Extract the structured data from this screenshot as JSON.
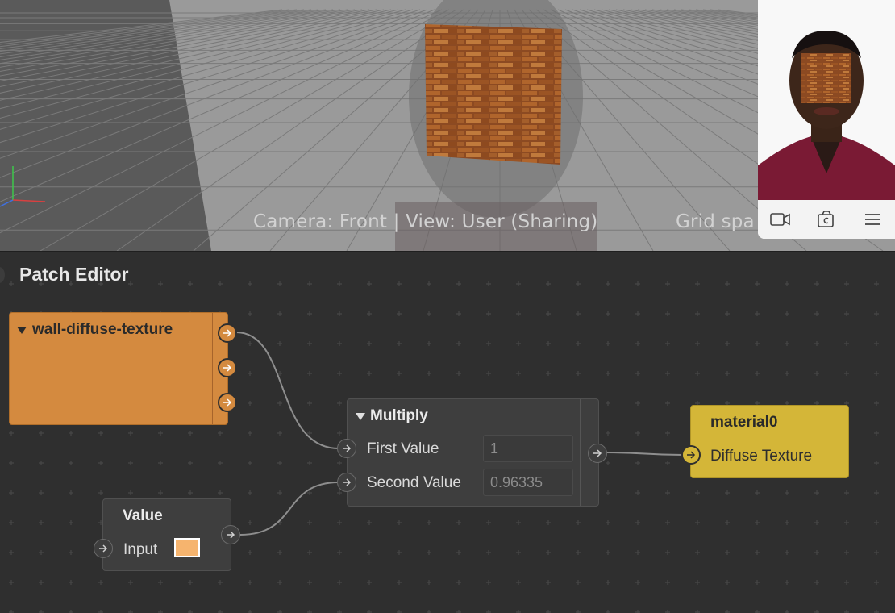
{
  "viewport": {
    "status_text": "Camera: Front | View: User (Sharing)",
    "grid_text": "Grid spa"
  },
  "video_call": {
    "controls": [
      "video-camera-icon",
      "flip-camera-icon",
      "menu-icon"
    ]
  },
  "patch_editor": {
    "title": "Patch Editor",
    "nodes": {
      "texture": {
        "title": "wall-diffuse-texture",
        "color": "#d48a3f"
      },
      "multiply": {
        "title": "Multiply",
        "first_label": "First Value",
        "first_value": "1",
        "second_label": "Second Value",
        "second_value": "0.96335"
      },
      "material": {
        "title": "material0",
        "port_label": "Diffuse Texture",
        "color": "#d4b638"
      },
      "value": {
        "title": "Value",
        "input_label": "Input",
        "swatch_color": "#f6b46e"
      }
    }
  }
}
